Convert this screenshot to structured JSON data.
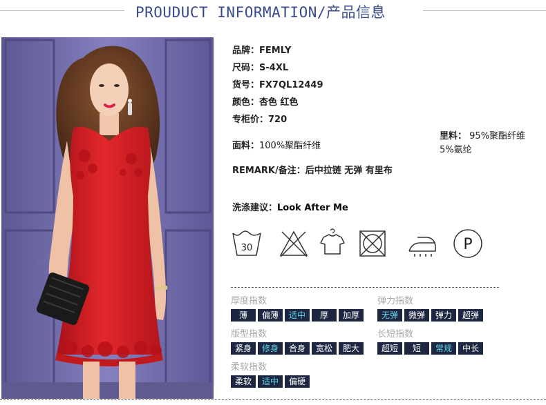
{
  "header": {
    "title": "PROUDUCT INFORMATION/产品信息"
  },
  "product": {
    "brand": {
      "label": "品牌：",
      "value": "FEMLY"
    },
    "size": {
      "label": "尺码：",
      "value": "S-4XL"
    },
    "sku": {
      "label": "货号：",
      "value": "FX7QL12449"
    },
    "color": {
      "label": "颜色：",
      "value": "杏色 红色"
    },
    "price": {
      "label": "专柜价：",
      "value": "720"
    },
    "fabric": {
      "label": "面料：",
      "value": "100%聚酯纤维"
    },
    "lining": {
      "label": "里料：",
      "value_line1": "95%聚酯纤维",
      "value_line2": "5%氨纶"
    },
    "remark": {
      "label": "REMARK/备注：",
      "value": "后中拉链 无弹 有里布"
    },
    "wash": {
      "label": "洗涤建议：",
      "value": "Look After Me"
    }
  },
  "care_icons": [
    {
      "name": "wash-30-icon",
      "text": "30"
    },
    {
      "name": "no-bleach-icon"
    },
    {
      "name": "hang-dry-icon"
    },
    {
      "name": "no-tumble-dry-icon"
    },
    {
      "name": "iron-icon"
    },
    {
      "name": "dry-clean-p-icon",
      "text": "P"
    }
  ],
  "indices": {
    "thickness": {
      "title": "厚度指数",
      "options": [
        "薄",
        "偏薄",
        "适中",
        "厚",
        "加厚"
      ],
      "selected": "适中"
    },
    "elasticity": {
      "title": "弹力指数",
      "options": [
        "无弹",
        "微弹",
        "弹力",
        "超弹"
      ],
      "selected": "无弹"
    },
    "fit": {
      "title": "版型指数",
      "options": [
        "紧身",
        "修身",
        "合身",
        "宽松",
        "肥大"
      ],
      "selected": "修身"
    },
    "length": {
      "title": "长短指数",
      "options": [
        "超短",
        "短",
        "常规",
        "中长"
      ],
      "selected": "常规"
    },
    "softness": {
      "title": "柔软指数",
      "options": [
        "柔软",
        "适中",
        "偏硬"
      ],
      "selected": "适中"
    }
  },
  "colors": {
    "accent": "#3a4a8e",
    "chip_bg": "#1d2741",
    "chip_selected_text": "#5fd8ef",
    "dress_red": "#d41f22"
  }
}
